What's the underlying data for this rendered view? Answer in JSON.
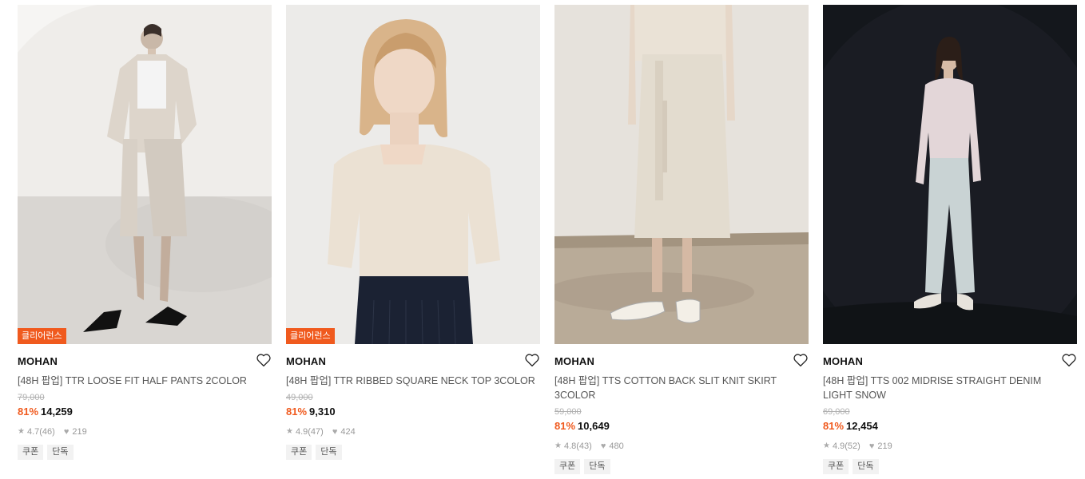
{
  "products": [
    {
      "badge": "클리어런스",
      "brand": "MOHAN",
      "title": "[48H 팝업] TTR LOOSE FIT HALF PANTS 2COLOR",
      "original_price": "79,000",
      "discount": "81%",
      "price": "14,259",
      "rating": "4.7",
      "reviews": "(46)",
      "likes": "219",
      "tags": [
        "쿠폰",
        "단독"
      ]
    },
    {
      "badge": "클리어런스",
      "brand": "MOHAN",
      "title": "[48H 팝업] TTR RIBBED SQUARE NECK TOP 3COLOR",
      "original_price": "49,000",
      "discount": "81%",
      "price": "9,310",
      "rating": "4.9",
      "reviews": "(47)",
      "likes": "424",
      "tags": [
        "쿠폰",
        "단독"
      ]
    },
    {
      "badge": "",
      "brand": "MOHAN",
      "title": "[48H 팝업] TTS COTTON BACK SLIT KNIT SKIRT 3COLOR",
      "original_price": "59,000",
      "discount": "81%",
      "price": "10,649",
      "rating": "4.8",
      "reviews": "(43)",
      "likes": "480",
      "tags": [
        "쿠폰",
        "단독"
      ]
    },
    {
      "badge": "",
      "brand": "MOHAN",
      "title": "[48H 팝업] TTS 002 MIDRISE STRAIGHT DENIM LIGHT SNOW",
      "original_price": "69,000",
      "discount": "81%",
      "price": "12,454",
      "rating": "4.9",
      "reviews": "(52)",
      "likes": "219",
      "tags": [
        "쿠폰",
        "단독"
      ]
    }
  ],
  "colors": {
    "accent": "#f05a1e",
    "text": "#222222",
    "muted": "#999999"
  },
  "icons": {
    "wishlist": "heart-outline-icon",
    "rating": "star-icon",
    "likes": "heart-filled-icon"
  }
}
